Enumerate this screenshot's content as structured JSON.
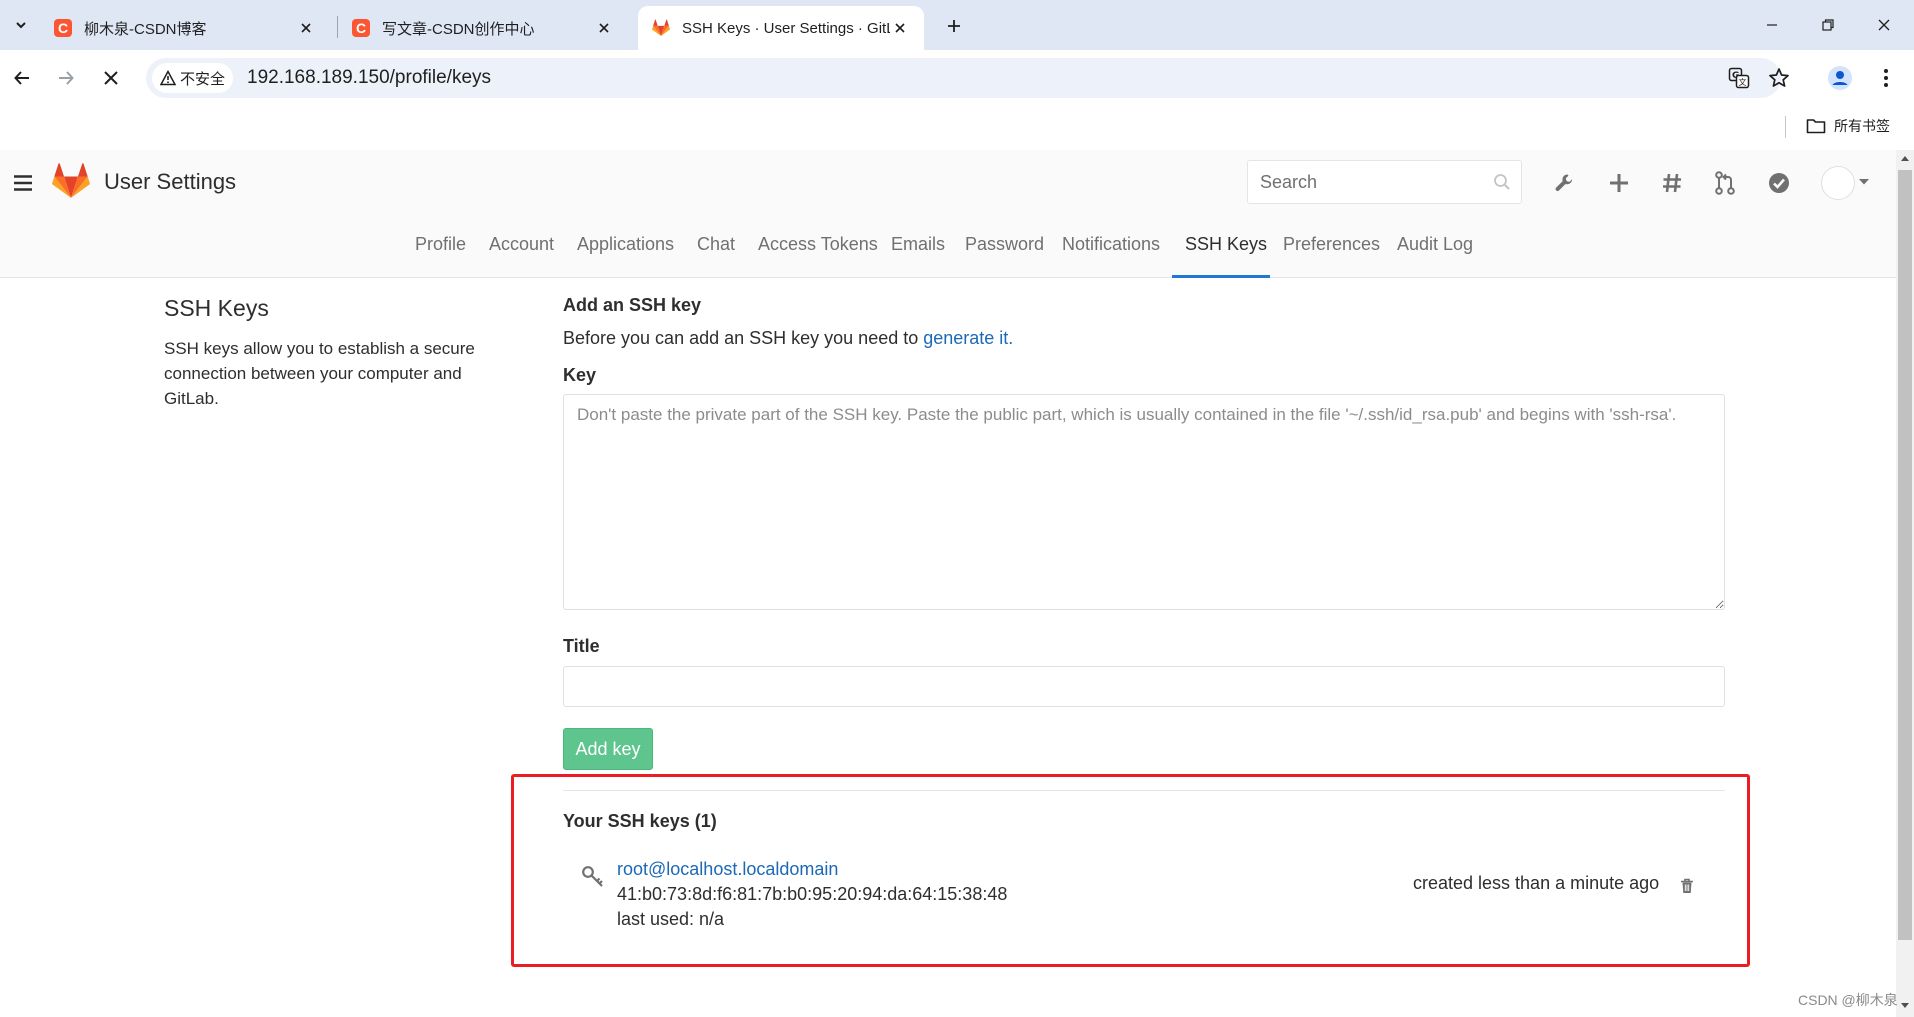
{
  "browser": {
    "tabs": [
      {
        "title": "柳木泉-CSDN博客",
        "favicon": "csdn-icon"
      },
      {
        "title": "写文章-CSDN创作中心",
        "favicon": "csdn-icon"
      },
      {
        "title": "SSH Keys · User Settings · GitLab",
        "favicon": "gitlab-icon"
      }
    ],
    "insecure_label": "不安全",
    "url": "192.168.189.150/profile/keys",
    "bookmarks_label": "所有书签"
  },
  "header": {
    "title": "User Settings",
    "search_placeholder": "Search"
  },
  "nav": {
    "items": [
      "Profile",
      "Account",
      "Applications",
      "Chat",
      "Access Tokens",
      "Emails",
      "Password",
      "Notifications",
      "SSH Keys",
      "Preferences",
      "Audit Log"
    ],
    "active": "SSH Keys"
  },
  "sidebar": {
    "title": "SSH Keys",
    "description": "SSH keys allow you to establish a secure connection between your computer and GitLab."
  },
  "form": {
    "heading": "Add an SSH key",
    "help_prefix": "Before you can add an SSH key you need to ",
    "help_link": "generate it.",
    "key_label": "Key",
    "key_placeholder": "Don't paste the private part of the SSH key. Paste the public part, which is usually contained in the file '~/.ssh/id_rsa.pub' and begins with 'ssh-rsa'.",
    "title_label": "Title",
    "title_value": "",
    "submit_label": "Add key"
  },
  "keys": {
    "heading": "Your SSH keys (1)",
    "items": [
      {
        "title": "root@localhost.localdomain",
        "fingerprint": "41:b0:73:8d:f6:81:7b:b0:95:20:94:da:64:15:38:48",
        "last_used": "last used: n/a",
        "created": "created less than a minute ago"
      }
    ]
  },
  "colors": {
    "link": "#1b69b6",
    "active_tab_underline": "#1f78d1",
    "add_button": "#5ec58e",
    "highlight_box": "#ea1c24"
  },
  "watermark": "CSDN @柳木泉"
}
